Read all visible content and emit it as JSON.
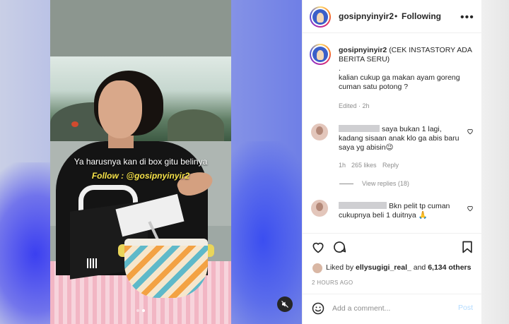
{
  "post": {
    "username": "gosipnyinyir2",
    "separator": "•",
    "follow_state": "Following",
    "more_icon": "more-horizontal-icon"
  },
  "media": {
    "caption_line1": "Ya harusnya kan di box gitu belinya",
    "caption_line2": "Follow : @gosipnyinyir2",
    "carousel_count": 2,
    "carousel_active": 2,
    "mute_icon": "muted-speaker-icon"
  },
  "caption": {
    "username": "gosipnyinyir2",
    "line1": "(CEK INSTASTORY ADA BERITA SERU)",
    "line2": ".",
    "line3": "kalian cukup ga makan ayam goreng cuman satu potong ?",
    "meta": "Edited · 2h"
  },
  "comments": [
    {
      "text": "saya bukan 1 lagi, kadang sisaan anak klo ga abis baru saya yg abisin😉",
      "time": "1h",
      "likes": "265 likes",
      "reply": "Reply",
      "view_replies": "View replies (18)"
    },
    {
      "text": "Bkn pelit tp cuman cukupnya beli 1 duitnya 🙏"
    }
  ],
  "actions": {
    "liked_prefix": "Liked by",
    "liked_user": "ellysugigi_real_",
    "liked_and": "and",
    "liked_count": "6,134 others",
    "timestamp": "2 HOURS AGO"
  },
  "add_comment": {
    "placeholder": "Add a comment...",
    "post_label": "Post"
  },
  "colors": {
    "text": "#262626",
    "muted": "#8e8e8e",
    "post_disabled": "#b3dbff",
    "caption_yellow": "#f7e34a"
  }
}
